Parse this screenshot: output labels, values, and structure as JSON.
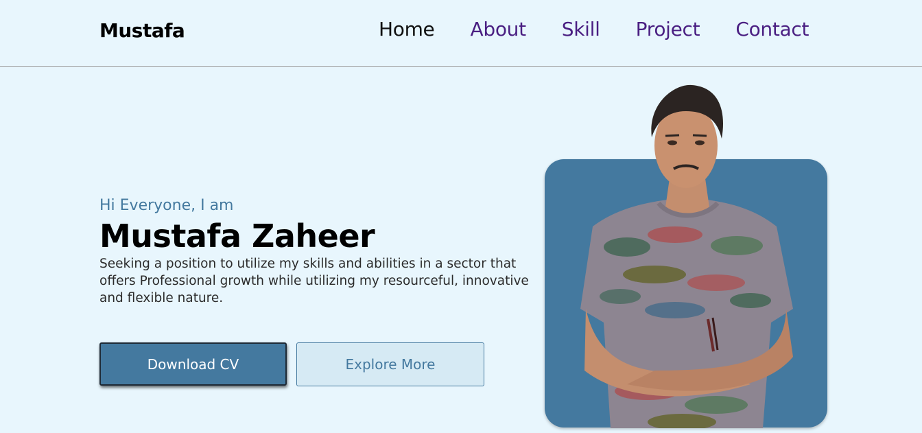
{
  "nav": {
    "logo": "Mustafa",
    "links": [
      {
        "label": "Home",
        "active": true
      },
      {
        "label": "About",
        "active": false
      },
      {
        "label": "Skill",
        "active": false
      },
      {
        "label": "Project",
        "active": false
      },
      {
        "label": "Contact",
        "active": false
      }
    ]
  },
  "hero": {
    "greeting": "Hi Everyone, I am",
    "name": "Mustafa Zaheer",
    "summary": "Seeking a position to utilize my skills and abilities in a sector that offers Professional growth while utilizing my resourceful, innovative and flexible nature.",
    "primary_button": "Download CV",
    "secondary_button": "Explore More",
    "photo": "profile-photo"
  },
  "colors": {
    "background": "#e8f6fd",
    "accent": "#44799f",
    "nav_link": "#4a1f82"
  }
}
